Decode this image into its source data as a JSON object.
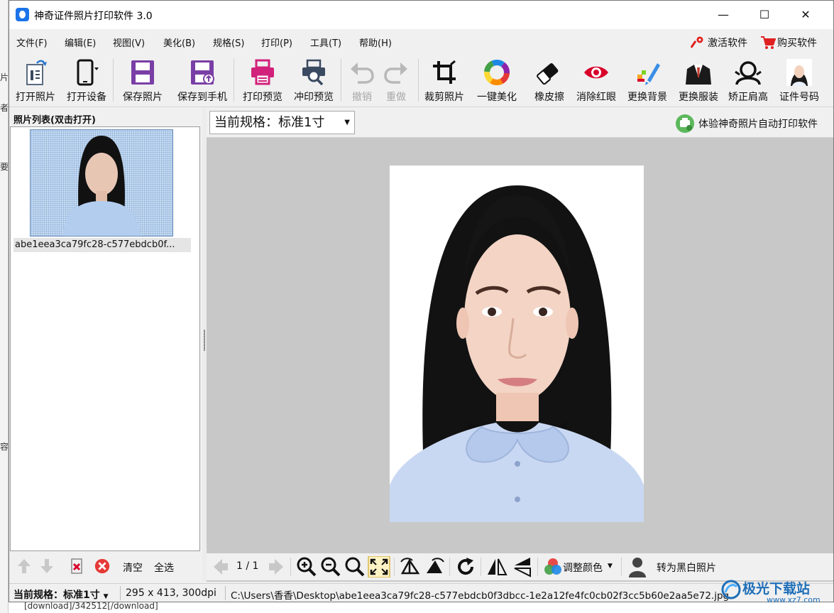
{
  "background": {
    "edge_chars": [
      "片",
      "者",
      "要",
      "容"
    ],
    "bottom_text": "[download]/342512[/download]"
  },
  "window": {
    "title": "神奇证件照片打印软件 3.0",
    "controls": {
      "minimize": "—",
      "maximize": "☐",
      "close": "✕"
    }
  },
  "menu": {
    "items": [
      "文件(F)",
      "编辑(E)",
      "视图(V)",
      "美化(B)",
      "规格(S)",
      "打印(P)",
      "工具(T)",
      "帮助(H)"
    ],
    "activate": "激活软件",
    "buy": "购买软件"
  },
  "toolbar": {
    "open_photo": "打开照片",
    "open_device": "打开设备",
    "save_photo": "保存照片",
    "save_to_phone": "保存到手机",
    "print_preview": "打印预览",
    "develop_preview": "冲印预览",
    "undo": "撤销",
    "redo": "重做",
    "crop": "裁剪照片",
    "beautify": "一键美化",
    "eraser": "橡皮擦",
    "redeye": "消除红眼",
    "bg": "更换背景",
    "clothes": "更换服装",
    "shoulder": "矫正肩高",
    "id_number": "证件号码"
  },
  "photo_list": {
    "title": "照片列表(双击打开)",
    "item_name": "abe1eea3ca79fc28-c577ebdcb0f...",
    "clear": "清空",
    "select_all": "全选"
  },
  "main": {
    "spec_label": "当前规格：标准1寸",
    "try_link": "体验神奇照片自动打印软件"
  },
  "bottom": {
    "page": "1 / 1",
    "adjust_color": "调整颜色",
    "to_bw": "转为黑白照片"
  },
  "status": {
    "spec": "当前规格：标准1寸",
    "size": "295 x 413, 300dpi",
    "path": "C:\\Users\\香香\\Desktop\\abe1eea3ca79fc28-c577ebdcb0f3dbcc-1e2a12fe4fc0cb02f3cc5b60e2aa5e72.jpg"
  },
  "watermark": {
    "text": "极光下载站",
    "url": "www.xz7.com"
  },
  "colors": {
    "purple_save": "#7a3fa6",
    "pink_print": "#d2217b",
    "red_eye": "#d8002a",
    "accent_blue": "#1a73e8"
  }
}
